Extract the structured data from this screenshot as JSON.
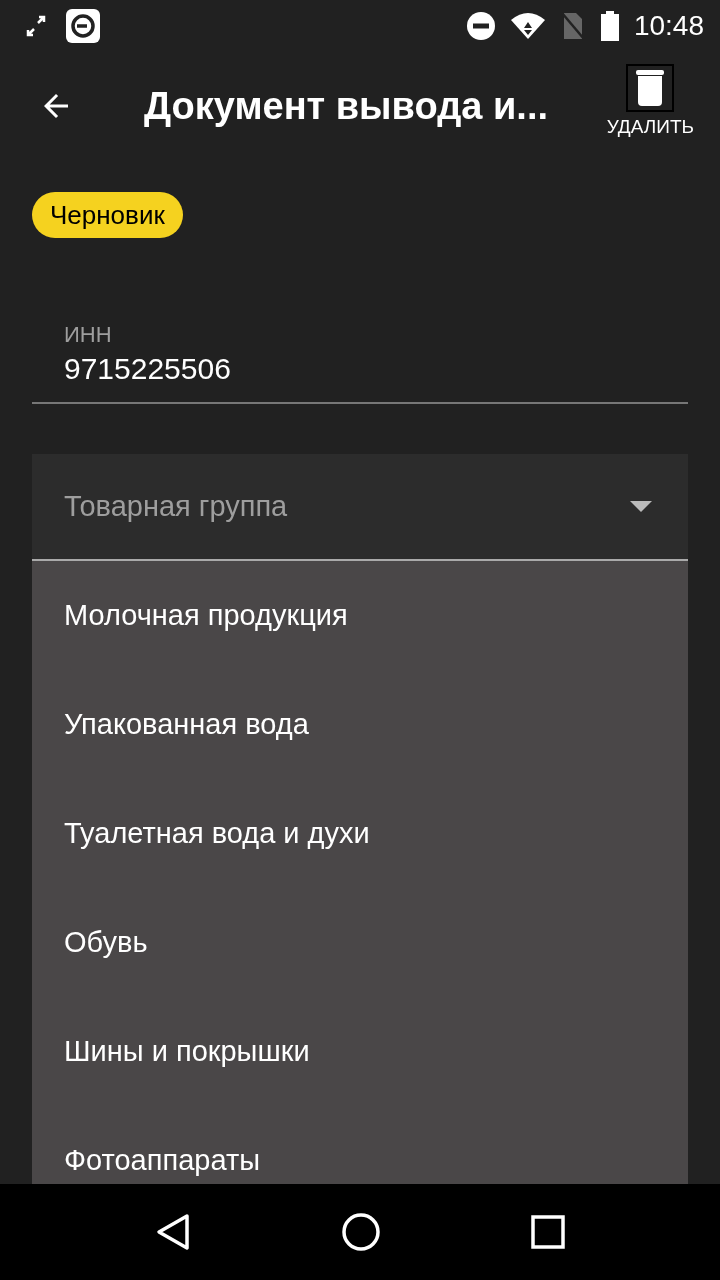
{
  "status_bar": {
    "time": "10:48"
  },
  "app_bar": {
    "title": "Документ вывода и...",
    "action": "УДАЛИТЬ"
  },
  "status_chip": "Черновик",
  "inn_field": {
    "label": "ИНН",
    "value": "9715225506"
  },
  "product_group": {
    "placeholder": "Товарная группа",
    "expanded": true,
    "options": [
      {
        "label": "Молочная продукция"
      },
      {
        "label": "Упакованная вода"
      },
      {
        "label": "Туалетная вода и духи"
      },
      {
        "label": "Обувь"
      },
      {
        "label": "Шины и покрышки"
      },
      {
        "label": "Фотоаппараты"
      }
    ]
  }
}
